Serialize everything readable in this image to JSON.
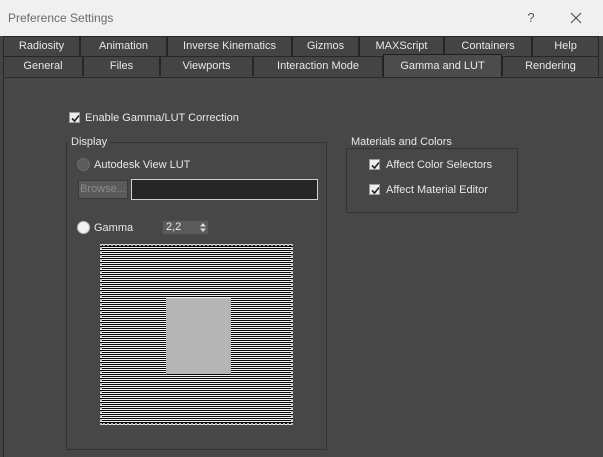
{
  "window": {
    "title": "Preference Settings",
    "help_label": "?"
  },
  "tabs": {
    "row1": [
      "Radiosity",
      "Animation",
      "Inverse Kinematics",
      "Gizmos",
      "MAXScript",
      "Containers",
      "Help"
    ],
    "row2": [
      "General",
      "Files",
      "Viewports",
      "Interaction Mode",
      "Gamma and LUT",
      "Rendering"
    ],
    "active": "Gamma and LUT"
  },
  "settings": {
    "enable_gamma_label": "Enable Gamma/LUT Correction",
    "enable_gamma_checked": true
  },
  "display_group": {
    "title": "Display",
    "lut_label": "Autodesk View LUT",
    "browse_label": "Browse...",
    "lut_path_value": "",
    "gamma_label": "Gamma",
    "gamma_value": "2,2",
    "selected_mode": "Gamma"
  },
  "materials_group": {
    "title": "Materials and Colors",
    "affect_color_selectors_label": "Affect Color Selectors",
    "affect_color_selectors_checked": true,
    "affect_material_editor_label": "Affect Material Editor",
    "affect_material_editor_checked": true
  },
  "icons": {
    "close": "close-icon",
    "check": "checkmark-icon",
    "spinner": "spinner-arrows-icon"
  },
  "colors": {
    "panel": "#474747",
    "titlebar": "#f0f0f0",
    "field_bg": "#262626"
  }
}
